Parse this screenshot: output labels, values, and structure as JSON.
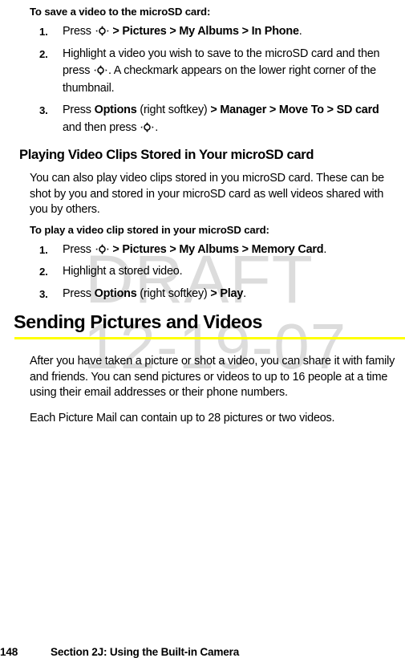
{
  "watermarks": {
    "draft": "DRAFT",
    "date": "12-19-07",
    "color": "#dcdcdc"
  },
  "accent_rule_color": "#ffff00",
  "icons": {
    "navigation_key": "navigation-key-icon"
  },
  "section_save_video": {
    "lead": "To save a video to the microSD card:",
    "steps": [
      {
        "number": "1.",
        "parts": [
          {
            "type": "text",
            "value": "Press "
          },
          {
            "type": "icon",
            "value": "navigation-key-icon"
          },
          {
            "type": "bold",
            "value": " > Pictures > My Albums > In Phone"
          },
          {
            "type": "text",
            "value": "."
          }
        ]
      },
      {
        "number": "2.",
        "parts": [
          {
            "type": "text",
            "value": "Highlight a video you wish to save to the microSD card and then press "
          },
          {
            "type": "icon",
            "value": "navigation-key-icon"
          },
          {
            "type": "text",
            "value": ". A checkmark appears on the lower right corner of the thumbnail."
          }
        ]
      },
      {
        "number": "3.",
        "parts": [
          {
            "type": "text",
            "value": "Press "
          },
          {
            "type": "bold",
            "value": "Options"
          },
          {
            "type": "text",
            "value": " (right softkey) "
          },
          {
            "type": "bold",
            "value": "> Manager > Move To > SD card"
          },
          {
            "type": "text",
            "value": " and then press "
          },
          {
            "type": "icon",
            "value": "navigation-key-icon"
          },
          {
            "type": "text",
            "value": "."
          }
        ]
      }
    ]
  },
  "section_playing": {
    "heading": "Playing Video Clips Stored in Your microSD card",
    "paragraph": "You can also play video clips stored in you microSD card. These can be shot by you and stored in your microSD card as well videos shared with you by others.",
    "lead": "To play a video clip stored in your microSD card:",
    "steps": [
      {
        "number": "1.",
        "parts": [
          {
            "type": "text",
            "value": "Press "
          },
          {
            "type": "icon",
            "value": "navigation-key-icon"
          },
          {
            "type": "bold",
            "value": " > Pictures > My Albums > Memory Card"
          },
          {
            "type": "text",
            "value": "."
          }
        ]
      },
      {
        "number": "2.",
        "parts": [
          {
            "type": "text",
            "value": "Highlight a stored video."
          }
        ]
      },
      {
        "number": "3.",
        "parts": [
          {
            "type": "text",
            "value": "Press "
          },
          {
            "type": "bold",
            "value": "Options"
          },
          {
            "type": "text",
            "value": " (right softkey) "
          },
          {
            "type": "bold",
            "value": "> Play"
          },
          {
            "type": "text",
            "value": "."
          }
        ]
      }
    ]
  },
  "section_sending": {
    "heading": "Sending Pictures and Videos",
    "paragraph_1": "After you have taken a picture or shot a video, you can share it with family and friends. You can send pictures or videos to up to 16 people at a time using their email addresses or their phone numbers.",
    "paragraph_2": "Each Picture Mail can contain up to 28 pictures or two videos."
  },
  "footer": {
    "page_number": "148",
    "section_title": "Section 2J: Using the Built-in Camera"
  }
}
